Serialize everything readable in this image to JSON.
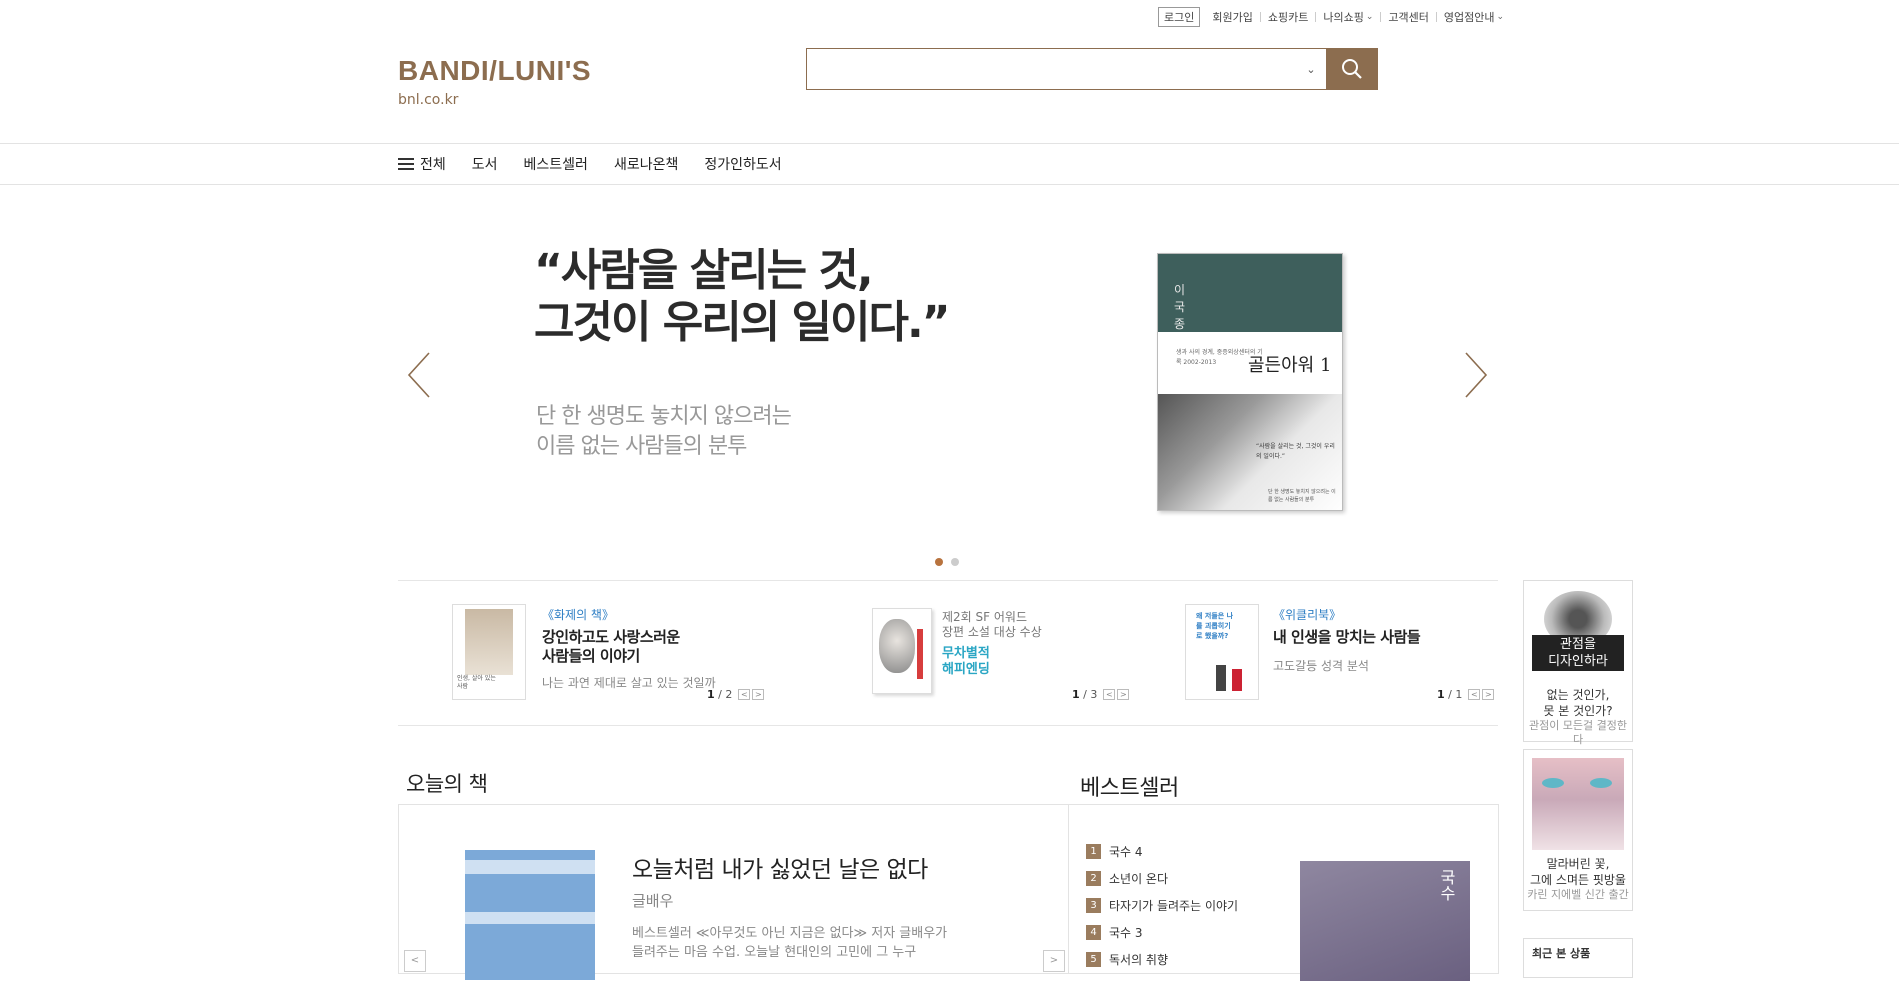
{
  "util": {
    "login": "로그인",
    "signup": "회원가입",
    "cart": "쇼핑카트",
    "my": "나의쇼핑",
    "support": "고객센터",
    "hours": "영업점안내"
  },
  "header": {
    "logo": "BANDI/LUNI'S",
    "domain": "bnl.co.kr",
    "search_placeholder": ""
  },
  "nav": {
    "all": "전체",
    "items": [
      "도서",
      "베스트셀러",
      "새로나온책",
      "정가인하도서"
    ]
  },
  "hero": {
    "quote_line1": "“사람을 살리는 것,",
    "quote_line2": "그것이 우리의 일이다.”",
    "sub_line1": "단 한 생명도 놓치지 않으려는",
    "sub_line2": "이름 없는 사람들의 분투",
    "cover": {
      "author": "이\n국\n종",
      "title": "골든아워 1",
      "small": "생과 사의 경계, 중증외상센터의 기록 2002-2013",
      "cover_quote": "“사람을 살리는 것, 그것이 우리의 일이다.”",
      "cover_bottom": "단 한 생명도 놓치지 않으려는 이름 없는 사람들의 분투"
    },
    "slides": 2,
    "active_slide": 1
  },
  "promos": [
    {
      "tag": "《화제의 책》",
      "title1": "강인하고도 사랑스러운",
      "title2": "사람들의 이야기",
      "desc": "나는 과연 제대로 살고 있는 것일까",
      "page": "1",
      "total": "/ 2",
      "thumb_text": "인생, 살아 있는 사람"
    },
    {
      "tag1": "제2회 SF 어워드",
      "tag2": "장편 소설 대상 수상",
      "title1": "무차별적",
      "title2": "해피엔딩",
      "page": "1",
      "total": "/ 3"
    },
    {
      "tag": "《위클리북》",
      "title1": "내 인생을 망치는 사람들",
      "desc": "고도갈등 성격 분석",
      "page": "1",
      "total": "/ 1",
      "thumb_text": "왜 저들은 나를 괴롭히기로 했을까?"
    }
  ],
  "sidebar": {
    "ad1": {
      "cover_text1": "관점을",
      "cover_text2": "디자인하라",
      "t1": "없는 것인가,",
      "t2": "못 본 것인가?",
      "g": "관점이 모든걸 결정한다"
    },
    "ad2": {
      "t1": "말라버린 꽃,",
      "t2": "그에 스며든 핏방울",
      "g": "카린 지에벨 신간 출간"
    },
    "recent": "최근 본 상품"
  },
  "today": {
    "heading": "오늘의 책",
    "title": "오늘처럼 내가 싫었던 날은 없다",
    "author": "글배우",
    "desc": "베스트셀러 ≪아무것도 아닌 지금은 없다≫ 저자 글배우가 들려주는 마음 수업. 오늘날 현대인의 고민에 그 누구"
  },
  "best": {
    "heading": "베스트셀러",
    "items": [
      {
        "rank": "1",
        "title": "국수 4"
      },
      {
        "rank": "2",
        "title": "소년이 온다"
      },
      {
        "rank": "3",
        "title": "타자기가 들려주는 이야기"
      },
      {
        "rank": "4",
        "title": "국수 3"
      },
      {
        "rank": "5",
        "title": "독서의 취향"
      }
    ],
    "cover_text": "국수"
  },
  "colors": {
    "brand": "#8c6d4f",
    "link": "#2d7ec4",
    "active_dot": "#b8733e"
  }
}
